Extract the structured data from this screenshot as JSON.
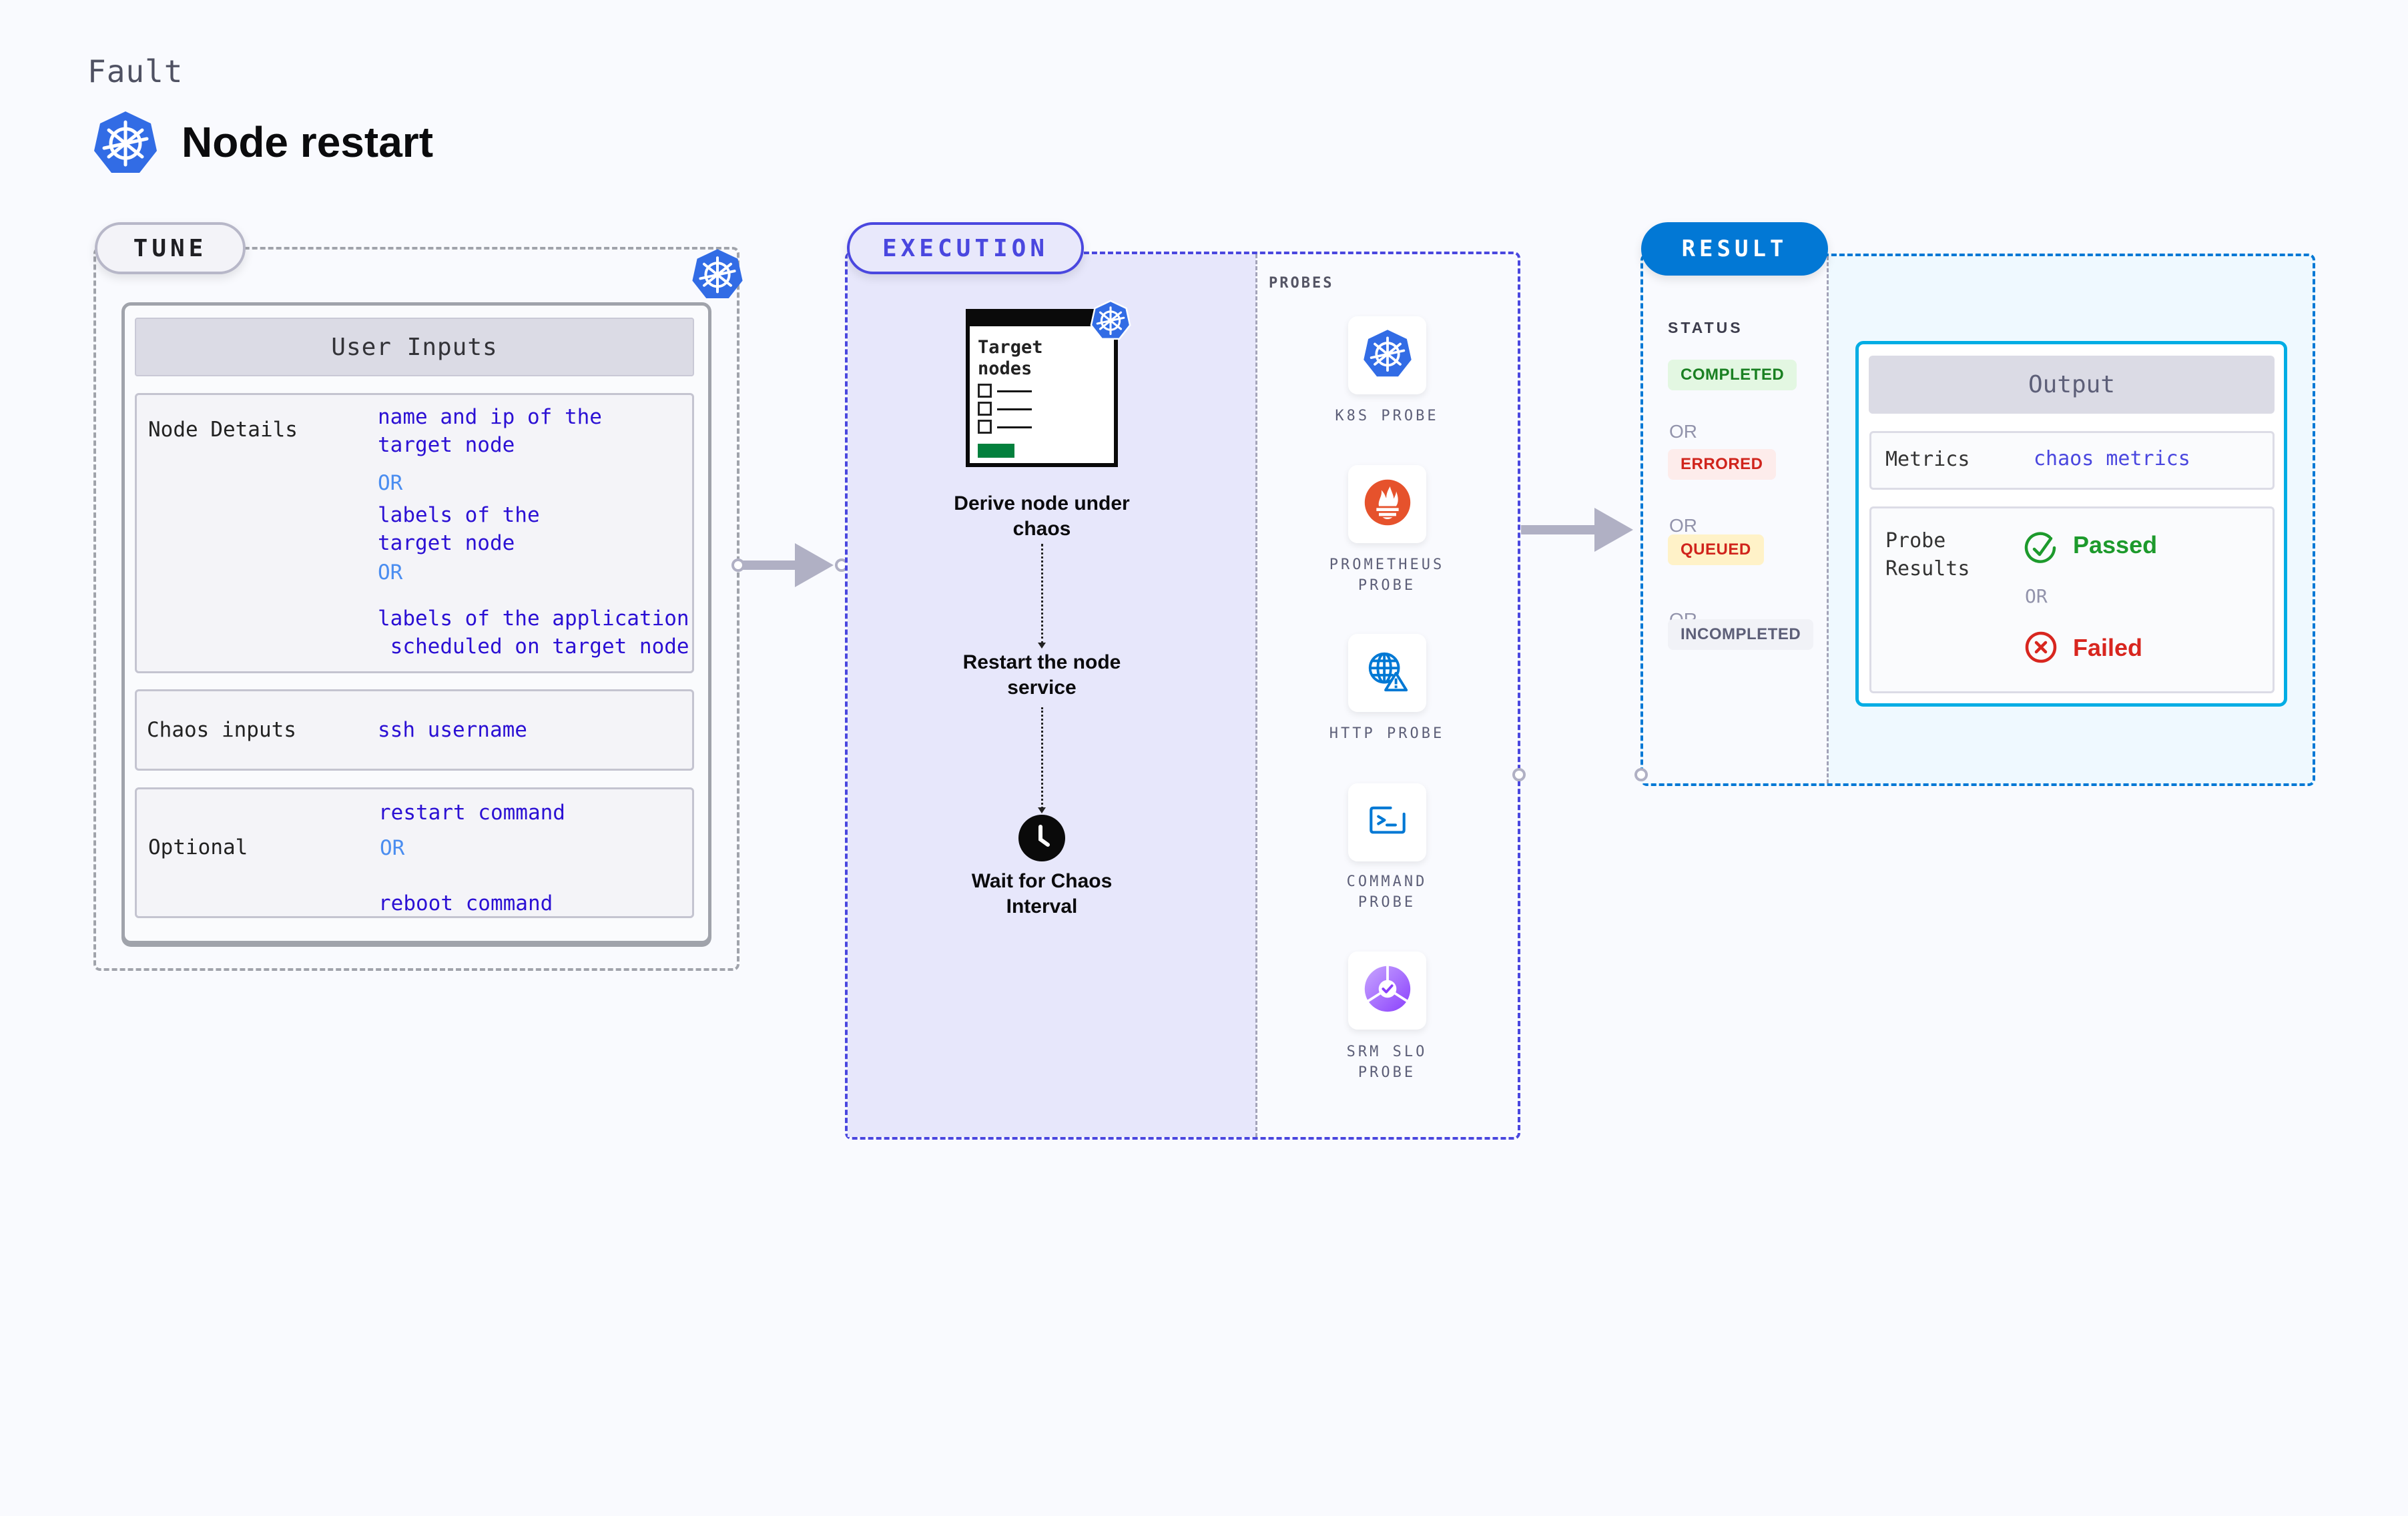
{
  "header": {
    "category": "Fault",
    "title": "Node restart",
    "title_icon": "kubernetes-icon"
  },
  "tune": {
    "label": "TUNE",
    "badge_icon": "kubernetes-icon",
    "user_inputs_title": "User Inputs",
    "node_details": {
      "label": "Node Details",
      "options": [
        "name and ip of the\ntarget node",
        "labels of the\ntarget node",
        "labels of the application\n scheduled on target node"
      ],
      "or_label": "OR"
    },
    "chaos_inputs": {
      "label": "Chaos inputs",
      "value": "ssh username"
    },
    "optional": {
      "label": "Optional",
      "options": [
        "restart command",
        "reboot command"
      ],
      "or_label": "OR"
    }
  },
  "execution": {
    "label": "EXECUTION",
    "target_card": {
      "title": "Target\nnodes",
      "badge_icon": "kubernetes-icon"
    },
    "steps": [
      "Derive node under\nchaos",
      "Restart the node\nservice",
      "Wait for Chaos\nInterval"
    ],
    "probes": {
      "title": "PROBES",
      "items": [
        {
          "label": "K8S PROBE",
          "icon": "kubernetes-icon"
        },
        {
          "label": "PROMETHEUS\nPROBE",
          "icon": "prometheus-icon"
        },
        {
          "label": "HTTP PROBE",
          "icon": "http-globe-warning-icon"
        },
        {
          "label": "COMMAND\nPROBE",
          "icon": "terminal-icon"
        },
        {
          "label": "SRM SLO\nPROBE",
          "icon": "srm-slo-icon"
        }
      ]
    }
  },
  "result": {
    "label": "RESULT",
    "status_title": "STATUS",
    "or_label": "OR",
    "statuses": [
      {
        "label": "COMPLETED",
        "bg": "#e3f7e2",
        "color": "#1a8022"
      },
      {
        "label": "ERRORED",
        "bg": "#fdeceb",
        "color": "#d0241c"
      },
      {
        "label": "QUEUED",
        "bg": "#fff2c8",
        "color": "#d0241c"
      },
      {
        "label": "INCOMPLETED",
        "bg": "#f1f2f7",
        "color": "#5d5f78"
      }
    ],
    "output": {
      "title": "Output",
      "metrics_label": "Metrics",
      "metrics_value": "chaos metrics",
      "probe_results_label": "Probe\nResults",
      "passed": "Passed",
      "failed": "Failed",
      "or_label": "OR"
    }
  },
  "colors": {
    "execution_accent": "#4a47df",
    "result_accent": "#0278d5",
    "output_border": "#00ade4",
    "kubernetes_blue": "#326ce5",
    "input_value": "#2b10d4"
  }
}
